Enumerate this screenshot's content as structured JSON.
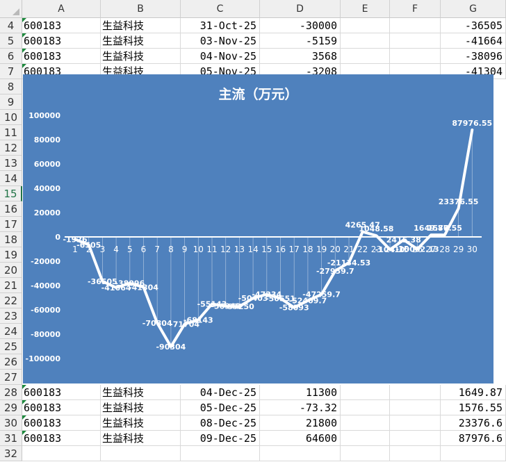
{
  "columns": [
    "A",
    "B",
    "C",
    "D",
    "E",
    "F",
    "G"
  ],
  "rows_top": [
    {
      "num": "4",
      "a": "600183",
      "b": "生益科技",
      "c": "31-Oct-25",
      "d": "-30000",
      "g": "-36505"
    },
    {
      "num": "5",
      "a": "600183",
      "b": "生益科技",
      "c": "03-Nov-25",
      "d": "-5159",
      "g": "-41664"
    },
    {
      "num": "6",
      "a": "600183",
      "b": "生益科技",
      "c": "04-Nov-25",
      "d": "3568",
      "g": "-38096"
    },
    {
      "num": "7",
      "a": "600183",
      "b": "生益科技",
      "c": "05-Nov-25",
      "d": "-3208",
      "g": "-41304"
    }
  ],
  "hidden_row_numbers": [
    "8",
    "9",
    "10",
    "11",
    "12",
    "13",
    "14",
    "15",
    "16",
    "17",
    "18",
    "19",
    "20",
    "21",
    "22",
    "23",
    "24",
    "25",
    "26",
    "27"
  ],
  "selected_row": "15",
  "rows_bottom": [
    {
      "num": "28",
      "a": "600183",
      "b": "生益科技",
      "c": "04-Dec-25",
      "d": "11300",
      "g": "1649.87"
    },
    {
      "num": "29",
      "a": "600183",
      "b": "生益科技",
      "c": "05-Dec-25",
      "d": "-73.32",
      "g": "1576.55"
    },
    {
      "num": "30",
      "a": "600183",
      "b": "生益科技",
      "c": "08-Dec-25",
      "d": "21800",
      "g": "23376.6"
    },
    {
      "num": "31",
      "a": "600183",
      "b": "生益科技",
      "c": "09-Dec-25",
      "d": "64600",
      "g": "87976.6"
    },
    {
      "num": "32",
      "a": "",
      "b": "",
      "c": "",
      "d": "",
      "g": ""
    }
  ],
  "chart_data": {
    "type": "line",
    "title": "主流（万元）",
    "x": [
      1,
      2,
      3,
      4,
      5,
      6,
      7,
      8,
      9,
      10,
      11,
      12,
      13,
      14,
      15,
      16,
      17,
      18,
      19,
      20,
      21,
      22,
      23,
      24,
      25,
      26,
      27,
      28,
      29,
      30
    ],
    "values": [
      -1926,
      -6505,
      -36505,
      -41664,
      -38096,
      -41304,
      -70804,
      -90304,
      -71704,
      -68143,
      -55143,
      -56943,
      -57250,
      -50403,
      -47234,
      -50551,
      -58093,
      -52409.7,
      -47259.7,
      -27959.7,
      -21134.53,
      4265.47,
      1048.58,
      -10410,
      -2415.38,
      -10002.13,
      1649.87,
      1576.55,
      23376.55,
      87976.55
    ],
    "data_labels": [
      "-1926",
      "-6505",
      "-36505",
      "-41664",
      "-38096",
      "-41304",
      "-70804",
      "-90304",
      "-71704",
      "-68143",
      "-55143",
      "-56943",
      "-57250",
      "-50403",
      "-47234",
      "-50551",
      "-58093",
      "-52409.7",
      "-47259.7",
      "-27959.7",
      "-21134.53",
      "4265.47",
      "1048.58",
      "-10410",
      "2415.38",
      "-10002.13",
      "1649.87",
      "1576.55",
      "23376.55",
      "87976.55"
    ],
    "y_ticks": [
      "100000",
      "80000",
      "60000",
      "40000",
      "20000",
      "0",
      "-20000",
      "-40000",
      "-60000",
      "-80000",
      "-100000"
    ],
    "ylim": [
      -100000,
      100000
    ],
    "grid": false,
    "colors": {
      "background": "#4f81bd",
      "line": "#ffffff",
      "text": "#ffffff"
    }
  },
  "colors": {
    "flag": "#1e8a3e",
    "selected_row": "#217346"
  }
}
